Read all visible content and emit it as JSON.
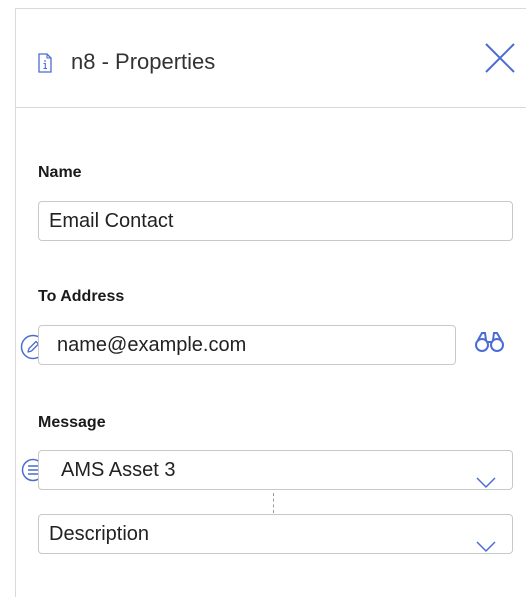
{
  "panel": {
    "title": "n8 - Properties",
    "icons": {
      "header": "info-document-icon",
      "close": "close-icon"
    }
  },
  "name": {
    "label": "Name",
    "value": "Email Contact"
  },
  "to_address": {
    "label": "To Address",
    "value": "name@example.com",
    "icons": {
      "left": "pencil-edit-icon",
      "right": "binoculars-icon"
    }
  },
  "message": {
    "label": "Message",
    "select1": "AMS Asset 3",
    "select2": "Description",
    "icons": {
      "left": "list-icon",
      "dropdown": "chevron-down-icon"
    }
  },
  "colors": {
    "accent": "#4a6cd4",
    "border": "#c9c9c9",
    "divider": "#d9d9d9"
  }
}
